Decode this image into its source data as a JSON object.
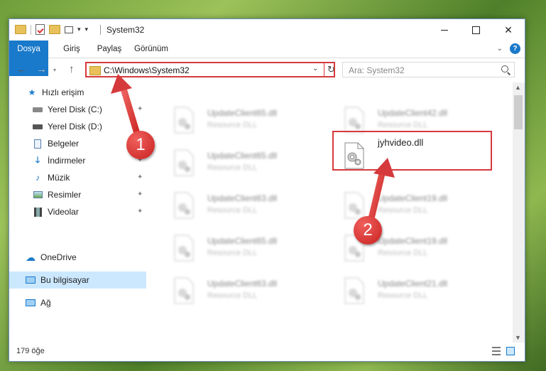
{
  "window": {
    "title": "System32"
  },
  "ribbon": {
    "tabs": [
      {
        "label": "Dosya"
      },
      {
        "label": "Giriş"
      },
      {
        "label": "Paylaş"
      },
      {
        "label": "Görünüm"
      }
    ]
  },
  "address": {
    "path": "C:\\Windows\\System32"
  },
  "search": {
    "placeholder": "Ara: System32"
  },
  "sidebar": {
    "items": [
      {
        "label": "Hızlı erişim",
        "icon": "star-icon"
      },
      {
        "label": "Yerel Disk (C:)",
        "icon": "drive-icon"
      },
      {
        "label": "Yerel Disk (D:)",
        "icon": "drive-icon"
      },
      {
        "label": "Belgeler",
        "icon": "documents-icon"
      },
      {
        "label": "İndirmeler",
        "icon": "download-icon"
      },
      {
        "label": "Müzik",
        "icon": "music-icon"
      },
      {
        "label": "Resimler",
        "icon": "pictures-icon"
      },
      {
        "label": "Videolar",
        "icon": "videos-icon"
      },
      {
        "label": "OneDrive",
        "icon": "cloud-icon"
      },
      {
        "label": "Bu bilgisayar",
        "icon": "computer-icon"
      },
      {
        "label": "Ağ",
        "icon": "network-icon"
      }
    ]
  },
  "files": [
    {
      "name": "UpdateClient65.dll",
      "type": "Resource DLL"
    },
    {
      "name": "UpdateClient42.dll",
      "type": "Resource DLL"
    },
    {
      "name": "UpdateClient65.dll",
      "type": "Resource DLL"
    },
    {
      "name": "jyhvideo.dll",
      "type": ""
    },
    {
      "name": "UpdateClient63.dll",
      "type": "Resource DLL"
    },
    {
      "name": "UpdateClient19.dll",
      "type": "Resource DLL"
    },
    {
      "name": "UpdateClient65.dll",
      "type": "Resource DLL"
    },
    {
      "name": "UpdateClient19.dll",
      "type": "Resource DLL"
    },
    {
      "name": "UpdateClient63.dll",
      "type": "Resource DLL"
    },
    {
      "name": "UpdateClient21.dll",
      "type": "Resource DLL"
    }
  ],
  "status": {
    "count": "179 öğe"
  },
  "annotations": {
    "step1": "1",
    "step2": "2"
  },
  "colors": {
    "accent": "#1979ca",
    "highlight": "#d6393c"
  }
}
